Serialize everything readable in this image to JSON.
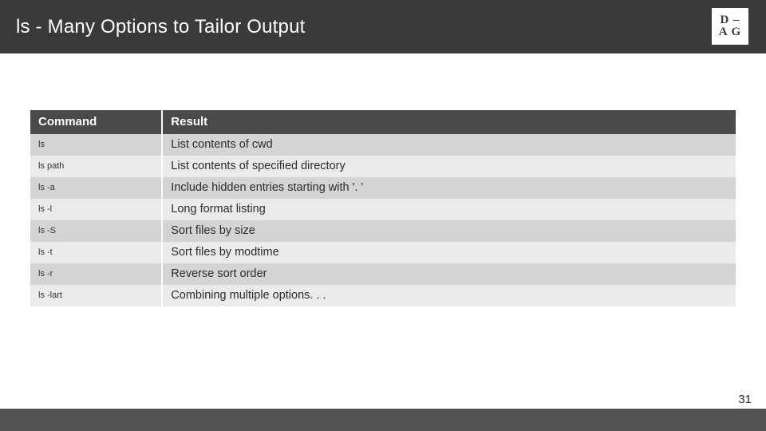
{
  "title": "ls - Many Options to Tailor Output",
  "logo": {
    "top": "D –",
    "mid": "–",
    "bot": "A G"
  },
  "table": {
    "headers": [
      "Command",
      "Result"
    ],
    "rows": [
      {
        "cmd": "ls",
        "result": "List contents of cwd"
      },
      {
        "cmd": "ls path",
        "result": "List contents of specified directory"
      },
      {
        "cmd": "ls -a",
        "result": "Include hidden entries starting with '. '"
      },
      {
        "cmd": "ls -l",
        "result": "Long format listing"
      },
      {
        "cmd": "ls -S",
        "result": "Sort files by size"
      },
      {
        "cmd": "ls -t",
        "result": "Sort files by modtime"
      },
      {
        "cmd": "ls -r",
        "result": "Reverse sort order"
      },
      {
        "cmd": "ls -lart",
        "result": "Combining multiple options. . ."
      }
    ]
  },
  "page_number": "31"
}
